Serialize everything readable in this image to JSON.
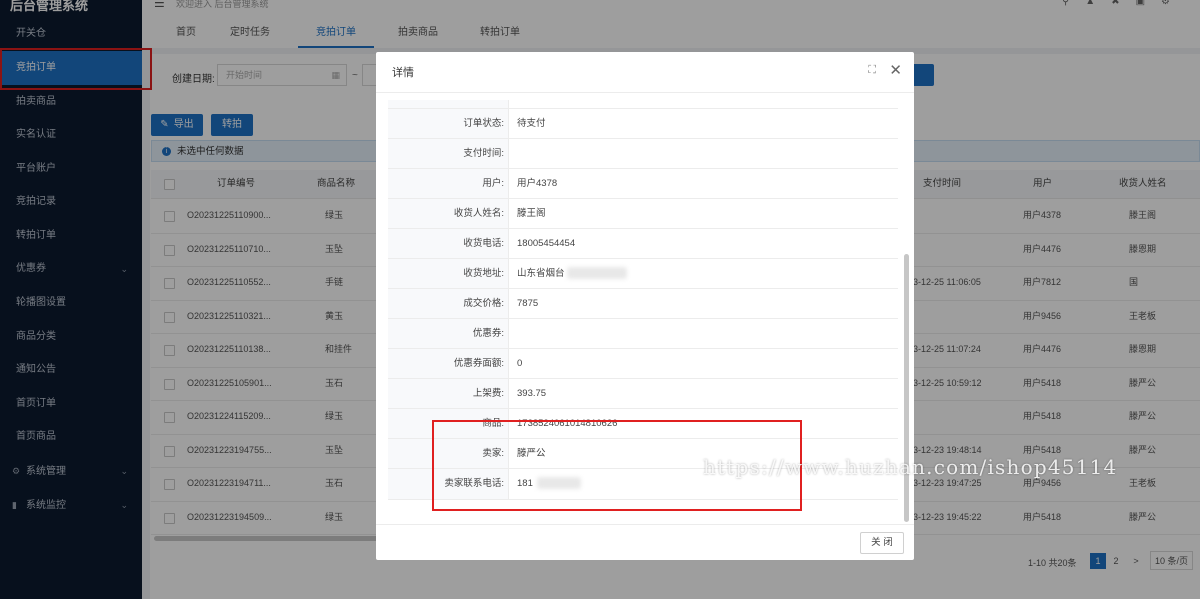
{
  "app": {
    "title": "后台管理系统"
  },
  "sidebar": {
    "items": [
      {
        "label": "开关仓"
      },
      {
        "label": "竞拍订单"
      },
      {
        "label": "拍卖商品"
      },
      {
        "label": "实名认证"
      },
      {
        "label": "平台账户"
      },
      {
        "label": "竞拍记录"
      },
      {
        "label": "转拍订单"
      },
      {
        "label": "优惠券"
      },
      {
        "label": "轮播图设置"
      },
      {
        "label": "商品分类"
      },
      {
        "label": "通知公告"
      },
      {
        "label": "首页订单"
      },
      {
        "label": "首页商品"
      },
      {
        "label": "系统管理"
      },
      {
        "label": "系统监控"
      }
    ]
  },
  "header": {
    "welcome": "欢迎进入 后台管理系统"
  },
  "tabs": [
    {
      "label": "首页"
    },
    {
      "label": "定时任务"
    },
    {
      "label": "竞拍订单"
    },
    {
      "label": "拍卖商品"
    },
    {
      "label": "转拍订单"
    }
  ],
  "filter": {
    "created_label": "创建日期:",
    "start_placeholder": "开始时间",
    "range_sep": "~"
  },
  "toolbar": {
    "export_label": "导出",
    "transfer_label": "转拍"
  },
  "alert": {
    "text": "未选中任何数据"
  },
  "table": {
    "columns": [
      "订单编号",
      "商品名称",
      "支付时间",
      "用户",
      "收货人姓名"
    ],
    "rows": [
      {
        "order": "O20231225110900...",
        "product": "绿玉",
        "paytime": "",
        "user": "用户4378",
        "receiver": "滕王阁"
      },
      {
        "order": "O20231225110710...",
        "product": "玉坠",
        "paytime": "",
        "user": "用户4476",
        "receiver": "滕恩期"
      },
      {
        "order": "O20231225110552...",
        "product": "手链",
        "paytime": "3-12-25 11:06:05",
        "user": "用户7812",
        "receiver": "国"
      },
      {
        "order": "O20231225110321...",
        "product": "黄玉",
        "paytime": "",
        "user": "用户9456",
        "receiver": "王老板"
      },
      {
        "order": "O20231225110138...",
        "product": "和挂件",
        "paytime": "3-12-25 11:07:24",
        "user": "用户4476",
        "receiver": "滕恩期"
      },
      {
        "order": "O20231225105901...",
        "product": "玉石",
        "paytime": "3-12-25 10:59:12",
        "user": "用户5418",
        "receiver": "滕严公"
      },
      {
        "order": "O20231224115209...",
        "product": "绿玉",
        "paytime": "",
        "user": "用户5418",
        "receiver": "滕严公"
      },
      {
        "order": "O20231223194755...",
        "product": "玉坠",
        "paytime": "3-12-23 19:48:14",
        "user": "用户5418",
        "receiver": "滕严公"
      },
      {
        "order": "O20231223194711...",
        "product": "玉石",
        "paytime": "3-12-23 19:47:25",
        "user": "用户9456",
        "receiver": "王老板"
      },
      {
        "order": "O20231223194509...",
        "product": "绿玉",
        "paytime": "3-12-23 19:45:22",
        "user": "用户5418",
        "receiver": "滕严公"
      }
    ]
  },
  "pagination": {
    "summary": "1-10 共20条",
    "pages": [
      "1",
      "2"
    ],
    "next": ">",
    "page_size": "10 条/页"
  },
  "modal": {
    "title": "详情",
    "fields": [
      {
        "label": "订单状态:",
        "value": "待支付"
      },
      {
        "label": "支付时间:",
        "value": ""
      },
      {
        "label": "用户:",
        "value": "用户4378"
      },
      {
        "label": "收货人姓名:",
        "value": "滕王阁"
      },
      {
        "label": "收货电话:",
        "value": "18005454454"
      },
      {
        "label": "收货地址:",
        "value": "山东省烟台"
      },
      {
        "label": "成交价格:",
        "value": "7875"
      },
      {
        "label": "优惠券:",
        "value": ""
      },
      {
        "label": "优惠券面额:",
        "value": "0"
      },
      {
        "label": "上架费:",
        "value": "393.75"
      },
      {
        "label": "商品:",
        "value": "1738524061014810626"
      },
      {
        "label": "卖家:",
        "value": "滕严公"
      },
      {
        "label": "卖家联系电话:",
        "value": "181"
      }
    ],
    "close_label": "关 闭"
  },
  "watermark": "https://www.huzhan.com/ishop45114",
  "colors": {
    "sidebar_bg": "#0c1a2f",
    "accent": "#1d72c6",
    "highlight": "#e02020"
  }
}
